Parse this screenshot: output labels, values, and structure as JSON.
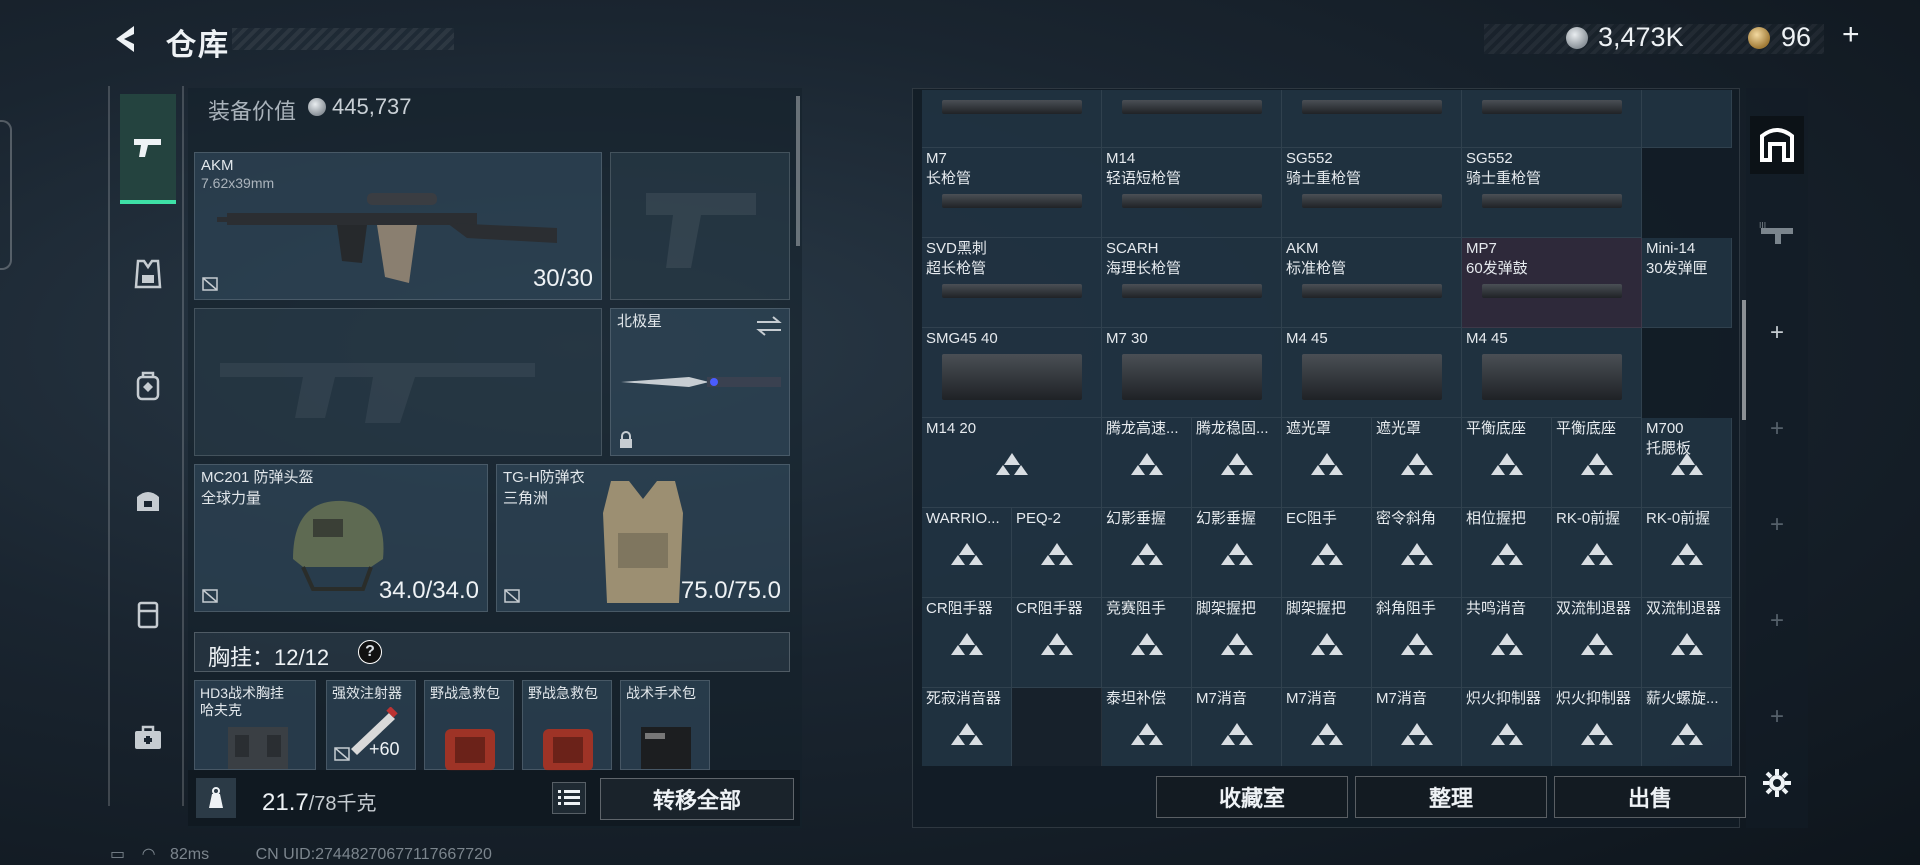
{
  "header": {
    "title": "仓库",
    "silver_amount": "3,473K",
    "gold_amount": "96",
    "plus": "+"
  },
  "left_nav": {
    "items": [
      {
        "icon": "pistol-icon",
        "active": true
      },
      {
        "icon": "vest-icon",
        "active": false
      },
      {
        "icon": "backpack-icon",
        "active": false
      },
      {
        "icon": "bag-icon",
        "active": false
      },
      {
        "icon": "box-icon",
        "active": false
      },
      {
        "icon": "medkit-icon",
        "active": false
      }
    ]
  },
  "loadout": {
    "equip_value_label": "装备价值",
    "equip_value": "445,737",
    "primary": {
      "name": "AKM",
      "caliber": "7.62x39mm",
      "ammo": "30/30"
    },
    "melee": {
      "name": "北极星"
    },
    "helmet": {
      "name": "MC201 防弹头盔",
      "brand": "全球力量",
      "durability": "34.0/34.0"
    },
    "armor": {
      "name": "TG-H防弹衣",
      "brand": "三角洲",
      "durability": "75.0/75.0"
    },
    "chest_rig": {
      "label": "胸挂：12/12",
      "help": "?"
    },
    "pockets": [
      {
        "line1": "HD3战术胸挂",
        "line2": "哈夫克"
      },
      {
        "line1": "强效注射器",
        "count": "+60"
      },
      {
        "line1": "野战急救包"
      },
      {
        "line1": "野战急救包"
      },
      {
        "line1": "战术手术包"
      }
    ],
    "weight": "21.7",
    "weight_max": "/78千克",
    "transfer_all": "转移全部"
  },
  "stash": {
    "rows": [
      [
        {
          "l1": "",
          "l2": ""
        },
        {
          "l1": "",
          "l2": ""
        },
        {
          "l1": "",
          "l2": ""
        },
        {
          "l1": "",
          "l2": ""
        },
        {
          "l1": "",
          "l2": ""
        }
      ],
      [
        {
          "l1": "M7",
          "l2": "长枪管"
        },
        {
          "l1": "M14",
          "l2": "轻语短枪管"
        },
        {
          "l1": "SG552",
          "l2": "骑士重枪管"
        },
        {
          "l1": "SG552",
          "l2": "骑士重枪管"
        }
      ],
      [
        {
          "l1": "SVD黑刺",
          "l2": "超长枪管"
        },
        {
          "l1": "SCARH",
          "l2": "海理长枪管"
        },
        {
          "l1": "AKM",
          "l2": "标准枪管"
        },
        {
          "l1": "MP7",
          "l2": "60发弹鼓"
        },
        {
          "l1": "Mini-14",
          "l2": "30发弹匣"
        }
      ],
      [
        {
          "l1": "SMG45 40"
        },
        {
          "l1": "M7 30"
        },
        {
          "l1": "M4 45"
        },
        {
          "l1": "M4 45"
        }
      ],
      [
        {
          "l1": "M14 20"
        },
        {
          "l1": "腾龙高速..."
        },
        {
          "l1": "腾龙稳固..."
        },
        {
          "l1": "遮光罩"
        },
        {
          "l1": "遮光罩"
        },
        {
          "l1": "平衡底座"
        },
        {
          "l1": "平衡底座"
        },
        {
          "l1": "M700",
          "l2": "托腮板"
        }
      ],
      [
        {
          "l1": "WARRIO..."
        },
        {
          "l1": "PEQ-2"
        },
        {
          "l1": "幻影垂握"
        },
        {
          "l1": "幻影垂握"
        },
        {
          "l1": "EC阻手"
        },
        {
          "l1": "密令斜角"
        },
        {
          "l1": "相位握把"
        },
        {
          "l1": "RK-0前握"
        },
        {
          "l1": "RK-0前握"
        }
      ],
      [
        {
          "l1": "CR阻手器"
        },
        {
          "l1": "CR阻手器"
        },
        {
          "l1": "竞赛阻手"
        },
        {
          "l1": "脚架握把"
        },
        {
          "l1": "脚架握把"
        },
        {
          "l1": "斜角阻手"
        },
        {
          "l1": "共鸣消音"
        },
        {
          "l1": "双流制退器"
        },
        {
          "l1": "双流制退器"
        }
      ],
      [
        {
          "l1": "死寂消音器"
        },
        {
          "l1": ""
        },
        {
          "l1": "泰坦补偿"
        },
        {
          "l1": "M7消音"
        },
        {
          "l1": "M7消音"
        },
        {
          "l1": "M7消音"
        },
        {
          "l1": "炽火抑制器"
        },
        {
          "l1": "炽火抑制器"
        },
        {
          "l1": "薪火螺旋..."
        }
      ]
    ],
    "buttons": {
      "collection": "收藏室",
      "sort": "整理",
      "sell": "出售"
    }
  },
  "right_side": {
    "items": [
      "stash-icon",
      "weapon-rack-icon",
      "+",
      "+",
      "+",
      "+",
      "+",
      "+"
    ]
  },
  "status": {
    "ping": "82ms",
    "uid": "CN UID:27448270677117667720"
  }
}
